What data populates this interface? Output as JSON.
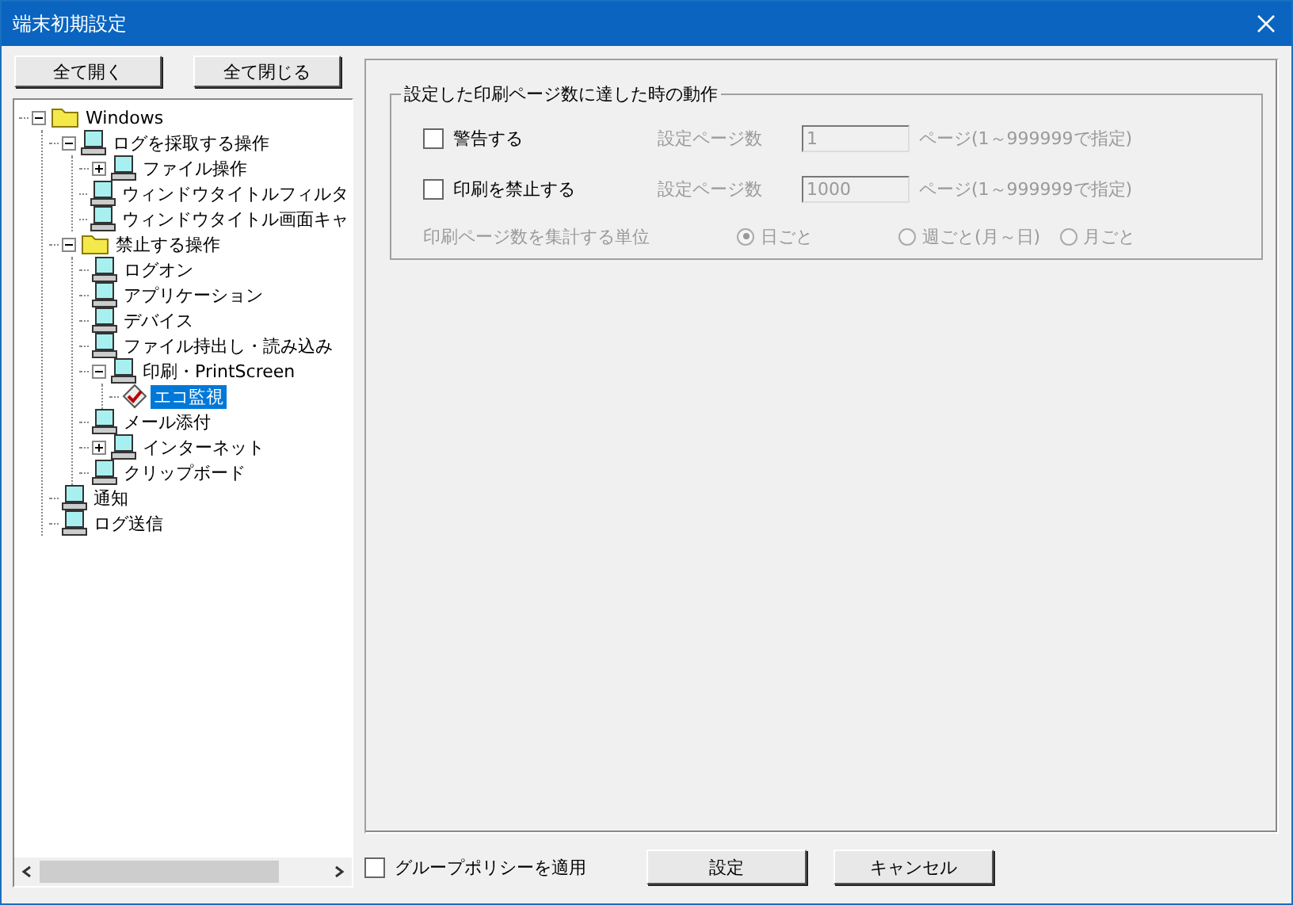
{
  "window": {
    "title": "端末初期設定"
  },
  "tree_buttons": [
    "全て開く",
    "全て閉じる"
  ],
  "tree": [
    {
      "label": "Windows",
      "kind": "folder",
      "expanded": true,
      "selected": false,
      "children": [
        {
          "label": "ログを採取する操作",
          "kind": "computer",
          "expanded": true,
          "selected": false,
          "children": [
            {
              "label": "ファイル操作",
              "kind": "computer",
              "expanded": false,
              "selected": false
            },
            {
              "label": "ウィンドウタイトルフィルタ",
              "kind": "computer",
              "selected": false
            },
            {
              "label": "ウィンドウタイトル画面キャ",
              "kind": "computer",
              "selected": false
            }
          ]
        },
        {
          "label": "禁止する操作",
          "kind": "folder",
          "expanded": true,
          "selected": false,
          "children": [
            {
              "label": "ログオン",
              "kind": "computer",
              "selected": false
            },
            {
              "label": "アプリケーション",
              "kind": "computer",
              "selected": false
            },
            {
              "label": "デバイス",
              "kind": "computer",
              "selected": false
            },
            {
              "label": "ファイル持出し・読み込み",
              "kind": "computer",
              "selected": false
            },
            {
              "label": "印刷・PrintScreen",
              "kind": "computer",
              "expanded": true,
              "selected": false,
              "children": [
                {
                  "label": "エコ監視",
                  "kind": "eco",
                  "selected": true
                }
              ]
            },
            {
              "label": "メール添付",
              "kind": "computer",
              "selected": false
            },
            {
              "label": "インターネット",
              "kind": "computer",
              "expanded": false,
              "selected": false
            },
            {
              "label": "クリップボード",
              "kind": "computer",
              "selected": false
            }
          ]
        },
        {
          "label": "通知",
          "kind": "computer",
          "selected": false
        },
        {
          "label": "ログ送信",
          "kind": "computer",
          "selected": false
        }
      ]
    }
  ],
  "group": {
    "title": "設定した印刷ページ数に達した時の動作",
    "rules": [
      {
        "label": "警告する",
        "checked": false,
        "count_label": "設定ページ数",
        "value": "1",
        "range": "ページ(1～999999で指定)",
        "disabled": true
      },
      {
        "label": "印刷を禁止する",
        "checked": false,
        "count_label": "設定ページ数",
        "value": "1000",
        "range": "ページ(1～999999で指定)",
        "disabled": true
      }
    ],
    "unit": {
      "label": "印刷ページ数を集計する単位",
      "disabled": true,
      "options": [
        {
          "label": "日ごと",
          "selected": true
        },
        {
          "label": "週ごと(月～日)",
          "selected": false
        },
        {
          "label": "月ごと",
          "selected": false
        }
      ]
    }
  },
  "group_policy": {
    "label": "グループポリシーを適用",
    "checked": false
  },
  "buttons": [
    "設定",
    "キャンセル"
  ]
}
